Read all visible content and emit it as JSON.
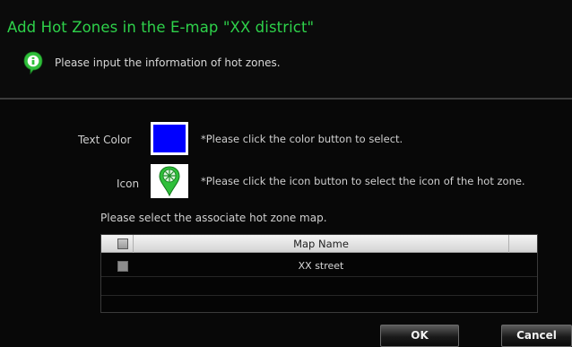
{
  "dialog": {
    "title": "Add Hot Zones in the E-map \"XX district\"",
    "subtitle": "Please input the information of hot zones."
  },
  "form": {
    "text_color_label": "Text Color",
    "text_color_hint": "*Please click the color button to select.",
    "text_color_value": "#0000ff",
    "icon_label": "Icon",
    "icon_hint": "*Please click the icon button to select the icon of the hot zone.",
    "map_prompt": "Please select the associate hot zone map."
  },
  "table": {
    "columns": [
      "Map Name"
    ],
    "rows": [
      {
        "map_name": "XX street",
        "checked": false
      }
    ]
  },
  "buttons": {
    "ok": "OK",
    "cancel": "Cancel"
  },
  "colors": {
    "title_green": "#2ed14a",
    "icon_green": "#2fbf3a"
  }
}
